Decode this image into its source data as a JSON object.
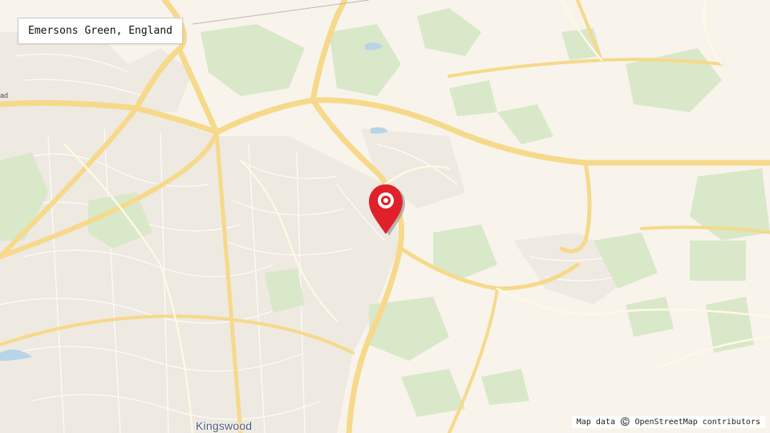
{
  "search": {
    "location_label": "Emersons Green, England"
  },
  "map": {
    "place_labels": {
      "kingswood": "Kingswood"
    },
    "road_label_fragment": "ad",
    "attribution": "Map data ©️ OpenStreetMap contributors",
    "marker_icon": "map-pin-icon",
    "colors": {
      "background": "#f8f4ec",
      "green_area": "#d8e8c8",
      "main_road": "#fbe3a3",
      "minor_road": "#ffffff",
      "urban": "#ece7df",
      "marker": "#e0202a"
    }
  }
}
